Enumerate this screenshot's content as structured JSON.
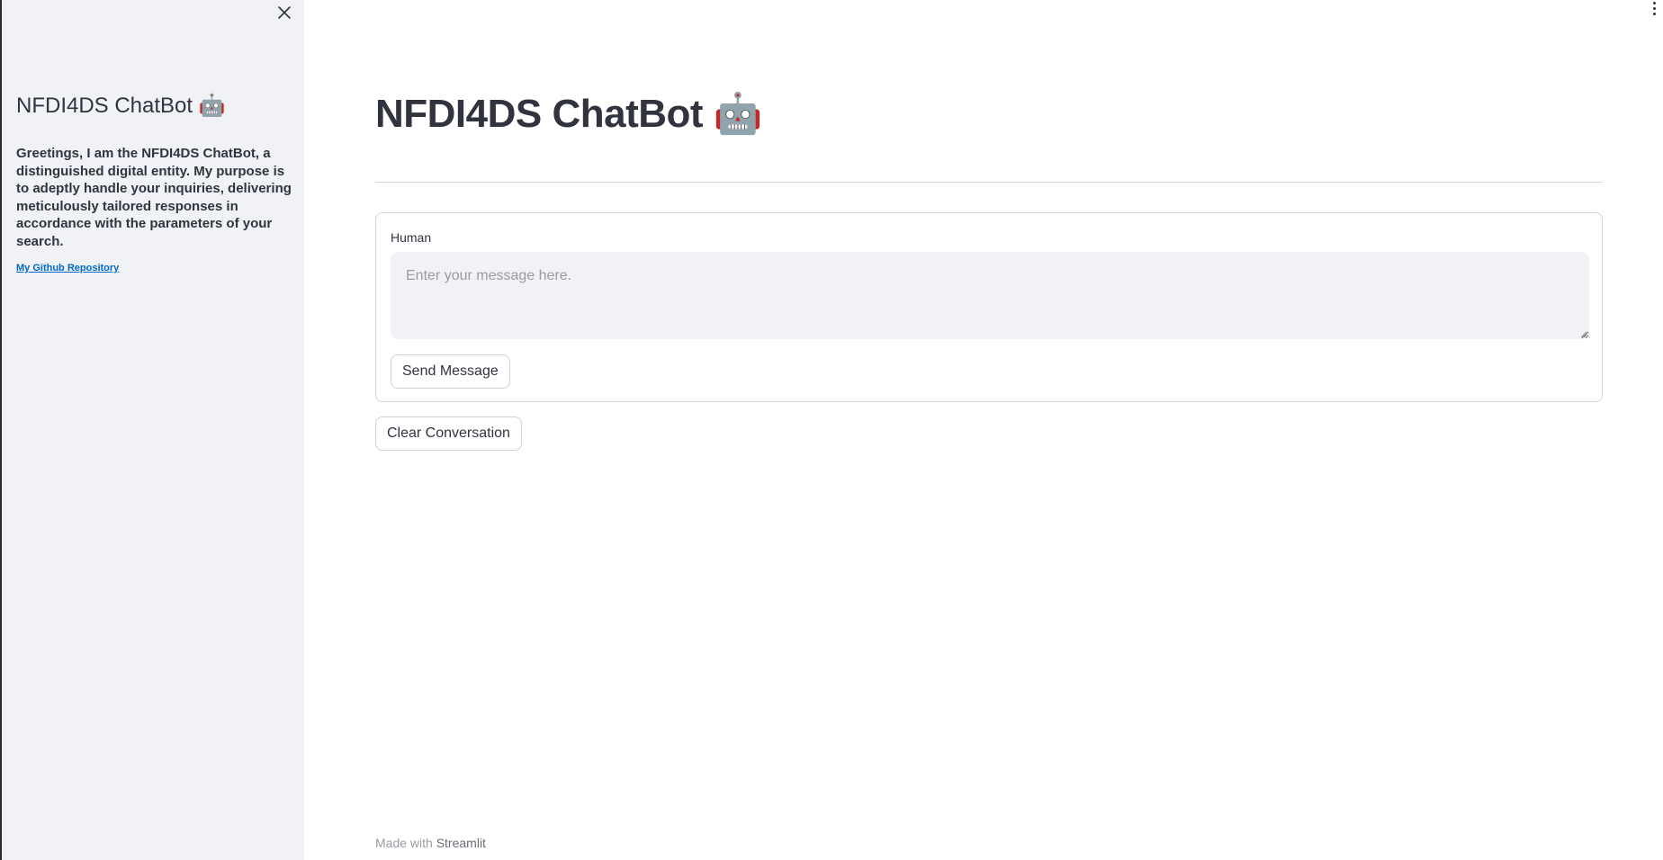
{
  "sidebar": {
    "title": "NFDI4DS ChatBot 🤖",
    "description": "Greetings, I am the NFDI4DS ChatBot, a distinguished digital entity. My purpose is to adeptly handle your inquiries, delivering meticulously tailored responses in accordance with the parameters of your search.",
    "link_label": "My Github Repository",
    "close_icon": "close-icon"
  },
  "header": {
    "menu_icon": "more-vertical-icon"
  },
  "main": {
    "title": "NFDI4DS ChatBot 🤖",
    "form": {
      "field_label": "Human",
      "input_value": "",
      "input_placeholder": "Enter your message here.",
      "send_label": "Send Message"
    },
    "clear_label": "Clear Conversation"
  },
  "footer": {
    "prefix": "Made with",
    "brand": "Streamlit"
  },
  "colors": {
    "sidebar_bg": "#f0f2f6",
    "text": "#31333f",
    "link": "#0068c9",
    "border": "#d6d6d9"
  }
}
